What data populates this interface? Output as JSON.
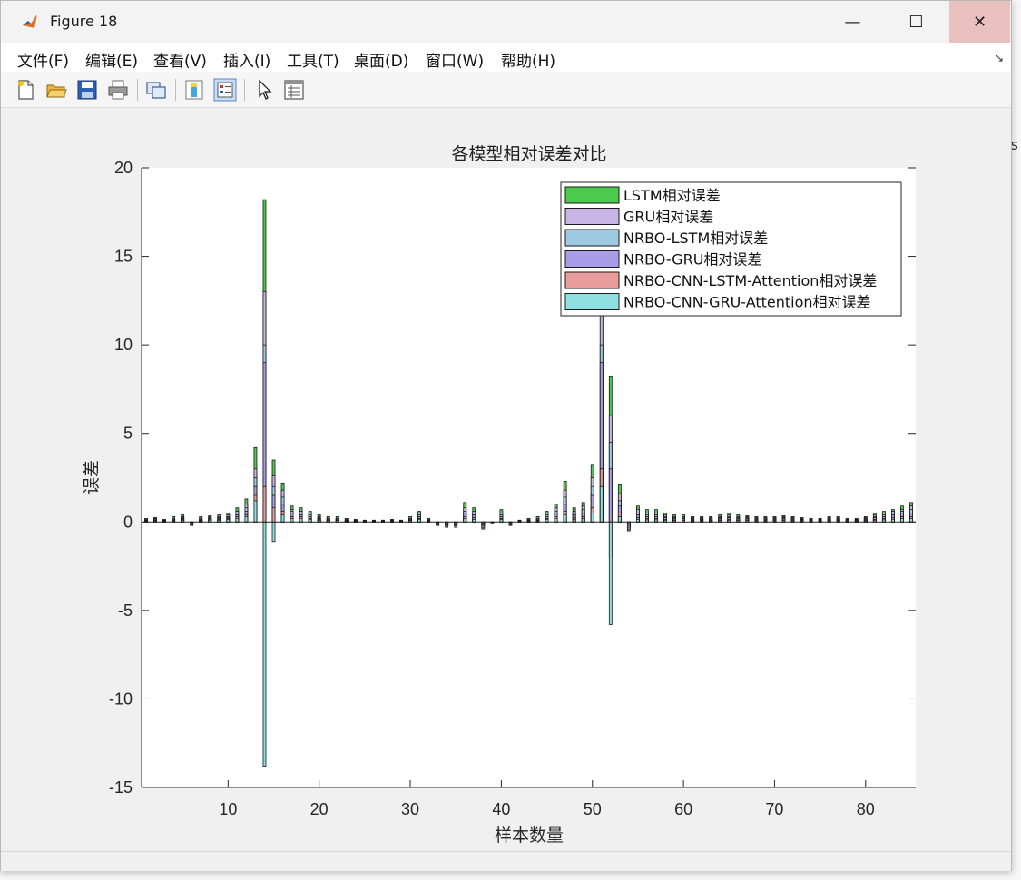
{
  "window": {
    "title": "Figure 18",
    "controls": {
      "minimize": "—",
      "maximize": "☐",
      "close": "✕"
    }
  },
  "menu": {
    "items": [
      "文件(F)",
      "编辑(E)",
      "查看(V)",
      "插入(I)",
      "工具(T)",
      "桌面(D)",
      "窗口(W)",
      "帮助(H)"
    ],
    "pin_icon": "dock-arrow-icon"
  },
  "toolbar": {
    "icons": [
      "new-figure-icon",
      "open-file-icon",
      "save-icon",
      "print-icon",
      "link-plot-icon",
      "insert-colorbar-icon",
      "insert-legend-icon",
      "edit-plot-icon",
      "property-inspector-icon"
    ]
  },
  "colors": {
    "lstm": "#4dc94d",
    "gru": "#c9b4e6",
    "nrbo_lstm": "#9ecae1",
    "nrbo_gru": "#a89de6",
    "nrbo_cnn_lstm_att": "#e89c9c",
    "nrbo_cnn_gru_att": "#8fe0e0",
    "axes_bg": "#ffffff"
  },
  "chart_data": {
    "type": "bar",
    "title": "各模型相对误差对比",
    "xlabel": "样本数量",
    "ylabel": "误差",
    "xlim": [
      0.5,
      85.5
    ],
    "ylim": [
      -15,
      20
    ],
    "yticks": [
      -15,
      -10,
      -5,
      0,
      5,
      10,
      15,
      20
    ],
    "xticks": [
      10,
      20,
      30,
      40,
      50,
      60,
      70,
      80
    ],
    "grid": false,
    "legend_position": "top-right",
    "series": [
      {
        "name": "LSTM相对误差",
        "values": [
          0.2,
          0.25,
          0.15,
          0.3,
          0.4,
          -0.2,
          0.3,
          0.35,
          0.4,
          0.5,
          0.8,
          1.3,
          4.2,
          18.2,
          3.5,
          2.2,
          0.9,
          0.8,
          0.6,
          0.4,
          0.3,
          0.3,
          0.2,
          0.15,
          0.1,
          0.1,
          0.1,
          0.15,
          0.1,
          0.3,
          0.6,
          0.2,
          -0.2,
          -0.3,
          -0.3,
          1.1,
          0.8,
          -0.4,
          -0.1,
          0.7,
          -0.2,
          0.1,
          0.2,
          0.3,
          0.6,
          1.0,
          2.3,
          0.8,
          1.1,
          3.2,
          15.8,
          8.2,
          2.1,
          -0.5,
          0.9,
          0.7,
          0.7,
          0.5,
          0.4,
          0.4,
          0.3,
          0.3,
          0.3,
          0.4,
          0.5,
          0.4,
          0.35,
          0.3,
          0.3,
          0.3,
          0.35,
          0.3,
          0.25,
          0.2,
          0.2,
          0.3,
          0.3,
          0.2,
          0.2,
          0.3,
          0.5,
          0.6,
          0.7,
          0.9,
          1.1
        ]
      },
      {
        "name": "GRU相对误差",
        "values": [
          0.15,
          0.2,
          0.1,
          0.2,
          0.3,
          -0.15,
          0.2,
          0.3,
          0.3,
          0.4,
          0.6,
          1.0,
          3.0,
          13.0,
          2.6,
          1.8,
          0.7,
          0.6,
          0.5,
          0.3,
          0.2,
          0.2,
          0.15,
          0.1,
          0.1,
          0.1,
          0.1,
          0.1,
          0.1,
          0.2,
          0.5,
          0.15,
          -0.15,
          -0.2,
          -0.2,
          0.8,
          0.6,
          -0.3,
          -0.1,
          0.5,
          -0.15,
          0.1,
          0.15,
          0.2,
          0.5,
          0.8,
          1.8,
          0.6,
          0.9,
          2.5,
          12.0,
          6.0,
          1.6,
          -0.4,
          0.7,
          0.5,
          0.5,
          0.4,
          0.3,
          0.3,
          0.25,
          0.25,
          0.25,
          0.3,
          0.4,
          0.3,
          0.3,
          0.25,
          0.25,
          0.25,
          0.3,
          0.25,
          0.2,
          0.15,
          0.15,
          0.25,
          0.25,
          0.15,
          0.15,
          0.25,
          0.4,
          0.5,
          0.6,
          0.7,
          0.9
        ]
      },
      {
        "name": "NRBO-LSTM相对误差",
        "values": [
          0.1,
          0.15,
          0.1,
          0.15,
          0.25,
          -0.1,
          0.15,
          0.25,
          0.25,
          0.3,
          0.5,
          0.8,
          2.5,
          10.0,
          2.0,
          1.4,
          0.6,
          0.5,
          0.4,
          0.25,
          0.2,
          0.2,
          0.1,
          0.1,
          0.08,
          0.08,
          0.08,
          0.1,
          0.08,
          0.2,
          0.4,
          0.1,
          -0.1,
          -0.15,
          -0.15,
          0.6,
          0.5,
          -0.2,
          -0.08,
          0.4,
          -0.1,
          0.08,
          0.1,
          0.15,
          0.4,
          0.6,
          1.4,
          0.5,
          0.7,
          2.0,
          10.0,
          4.5,
          1.2,
          -0.3,
          0.5,
          0.4,
          0.4,
          0.3,
          0.25,
          0.25,
          0.2,
          0.2,
          0.2,
          0.25,
          0.3,
          0.25,
          0.25,
          0.2,
          0.2,
          0.2,
          0.25,
          0.2,
          0.15,
          0.12,
          0.12,
          0.2,
          0.2,
          0.12,
          0.12,
          0.2,
          0.3,
          0.4,
          0.5,
          0.6,
          0.7
        ]
      },
      {
        "name": "NRBO-GRU相对误差",
        "values": [
          0.08,
          0.1,
          0.08,
          0.1,
          0.2,
          -0.08,
          0.1,
          0.2,
          0.2,
          0.25,
          0.4,
          0.6,
          2.0,
          9.0,
          1.5,
          1.0,
          0.5,
          0.4,
          0.3,
          0.2,
          0.15,
          0.15,
          0.08,
          0.08,
          0.06,
          0.06,
          0.06,
          0.08,
          0.06,
          0.15,
          0.3,
          0.08,
          -0.08,
          -0.1,
          -0.1,
          0.5,
          0.4,
          -0.15,
          -0.06,
          0.3,
          -0.08,
          0.06,
          0.08,
          0.1,
          0.3,
          0.5,
          1.0,
          0.4,
          0.5,
          1.5,
          9.0,
          3.0,
          0.9,
          -0.2,
          0.4,
          0.3,
          0.3,
          0.25,
          0.2,
          0.2,
          0.15,
          0.15,
          0.15,
          0.2,
          0.25,
          0.2,
          0.2,
          0.15,
          0.15,
          0.15,
          0.2,
          0.15,
          0.12,
          0.1,
          0.1,
          0.15,
          0.15,
          0.1,
          0.1,
          0.15,
          0.25,
          0.3,
          0.4,
          0.5,
          0.5
        ]
      },
      {
        "name": "NRBO-CNN-LSTM-Attention相对误差",
        "values": [
          0.05,
          0.08,
          0.05,
          0.08,
          0.15,
          -0.05,
          0.08,
          0.15,
          0.15,
          0.2,
          0.3,
          0.4,
          1.5,
          2.0,
          0.8,
          0.6,
          0.3,
          0.3,
          0.2,
          0.15,
          0.1,
          0.1,
          0.05,
          0.05,
          0.04,
          0.04,
          0.04,
          0.05,
          0.04,
          0.1,
          0.2,
          0.05,
          -0.05,
          -0.08,
          -0.08,
          0.3,
          0.25,
          -0.1,
          -0.04,
          0.2,
          -0.05,
          0.04,
          0.05,
          0.08,
          0.2,
          0.3,
          0.6,
          0.25,
          0.3,
          0.8,
          3.0,
          -2.0,
          0.5,
          -0.1,
          0.25,
          0.2,
          0.2,
          0.15,
          0.12,
          0.12,
          0.1,
          0.1,
          0.1,
          0.12,
          0.15,
          0.12,
          0.12,
          0.1,
          0.1,
          0.1,
          0.12,
          0.1,
          0.08,
          0.06,
          0.06,
          0.1,
          0.1,
          0.06,
          0.06,
          0.1,
          0.15,
          0.2,
          0.25,
          0.3,
          0.3
        ]
      },
      {
        "name": "NRBO-CNN-GRU-Attention相对误差",
        "values": [
          0.04,
          0.06,
          0.04,
          0.06,
          0.1,
          -0.04,
          0.06,
          0.1,
          0.1,
          0.15,
          0.2,
          0.3,
          1.2,
          -13.8,
          -1.1,
          0.4,
          0.2,
          0.2,
          0.15,
          0.1,
          0.08,
          0.08,
          0.04,
          0.04,
          0.03,
          0.03,
          0.03,
          0.04,
          0.03,
          0.08,
          0.15,
          0.04,
          -0.04,
          -0.05,
          -0.05,
          0.2,
          0.15,
          -0.08,
          -0.03,
          0.15,
          -0.04,
          0.03,
          0.04,
          0.05,
          0.15,
          0.2,
          0.4,
          0.15,
          0.2,
          0.5,
          2.0,
          -5.8,
          0.3,
          -0.08,
          0.15,
          0.12,
          0.12,
          0.1,
          0.08,
          0.08,
          0.06,
          0.06,
          0.06,
          0.08,
          0.1,
          0.08,
          0.08,
          0.06,
          0.06,
          0.06,
          0.08,
          0.06,
          0.05,
          0.04,
          0.04,
          0.06,
          0.06,
          0.04,
          0.04,
          0.06,
          0.1,
          0.12,
          0.15,
          0.2,
          0.2
        ]
      }
    ]
  }
}
